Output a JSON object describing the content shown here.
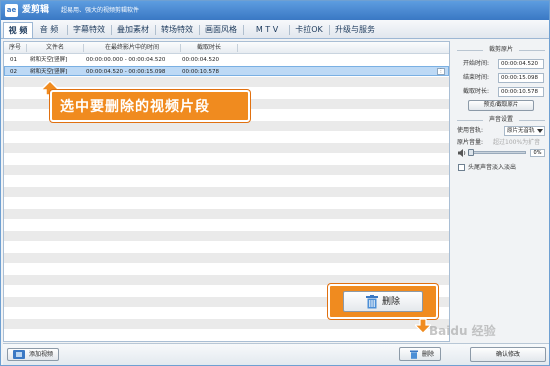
{
  "app": {
    "title": "爱剪辑",
    "slogan": "超易用、强大的视频剪辑软件",
    "logo_text": "ae"
  },
  "tabs": [
    {
      "label": "视 频",
      "active": true
    },
    {
      "label": "音 频"
    },
    {
      "label": "字幕特效"
    },
    {
      "label": "叠加素材"
    },
    {
      "label": "转场特效"
    },
    {
      "label": "画面风格"
    },
    {
      "label": "M T V"
    },
    {
      "label": "卡拉OK"
    },
    {
      "label": "升级与服务"
    }
  ],
  "table": {
    "columns": [
      "序号",
      "文件名",
      "在最终影片中的时间",
      "截取时长"
    ],
    "rows": [
      {
        "index": "01",
        "filename": "树和天空[竖屏]",
        "time_range": "00:00:00.000 - 00:00:04.520",
        "duration": "00:00:04.520",
        "selected": false
      },
      {
        "index": "02",
        "filename": "树和天空[竖屏]",
        "time_range": "00:00:04.520 - 00:00:15.098",
        "duration": "00:00:10.578",
        "selected": true
      }
    ],
    "row_more_icon": "⋮"
  },
  "callout": {
    "text": "选中要删除的视频片段"
  },
  "big_delete": {
    "label": "删除"
  },
  "right_panel": {
    "clip_section_title": "裁剪原片",
    "start_label": "开始时间:",
    "start_value": "00:00:04.520",
    "end_label": "结束时间:",
    "end_value": "00:00:15.098",
    "duration_label": "截取时长:",
    "duration_value": "00:00:10.578",
    "preview_button": "预览/截取原片",
    "audio_section_title": "声音设置",
    "track_label": "使用音轨:",
    "track_value": "原片无音轨",
    "volume_label": "原片音量:",
    "volume_hint": "超过100%为扩音",
    "volume_value": "0%",
    "volume_level": 0,
    "fade_label": "头尾声音淡入淡出"
  },
  "bottom_bar": {
    "add_video": "添加视频",
    "delete": "删除",
    "confirm": "确认修改"
  },
  "watermark": "Baidu 经验",
  "colors": {
    "accent_orange": "#f08b1f",
    "title_blue": "#3a78c4",
    "selection": "#bdd9f5"
  }
}
